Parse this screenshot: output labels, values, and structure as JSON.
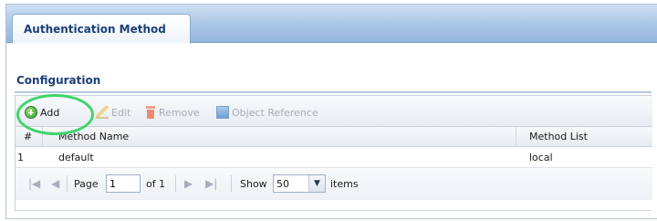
{
  "tabs": [
    {
      "label": "Authentication Method",
      "active": true
    }
  ],
  "section": {
    "title": "Configuration"
  },
  "toolbar": {
    "add_label": "Add",
    "edit_label": "Edit",
    "remove_label": "Remove",
    "object_reference_label": "Object Reference"
  },
  "table": {
    "columns": [
      "#",
      "Method Name",
      "Method List"
    ],
    "rows": [
      {
        "index": "1",
        "method_name": "default",
        "method_list": "local"
      }
    ]
  },
  "pager": {
    "page_label": "Page",
    "page_value": "1",
    "of_label": "of 1",
    "show_label": "Show",
    "show_value": "50",
    "items_label": "items"
  },
  "colors": {
    "tab_text": "#1c3f78",
    "highlight_ring": "#3fd46c",
    "add_icon": "#2f9a2f"
  },
  "icons": [
    "add-icon",
    "edit-icon",
    "remove-icon",
    "object-reference-icon",
    "first-page-icon",
    "prev-page-icon",
    "next-page-icon",
    "last-page-icon",
    "dropdown-arrow-icon"
  ]
}
